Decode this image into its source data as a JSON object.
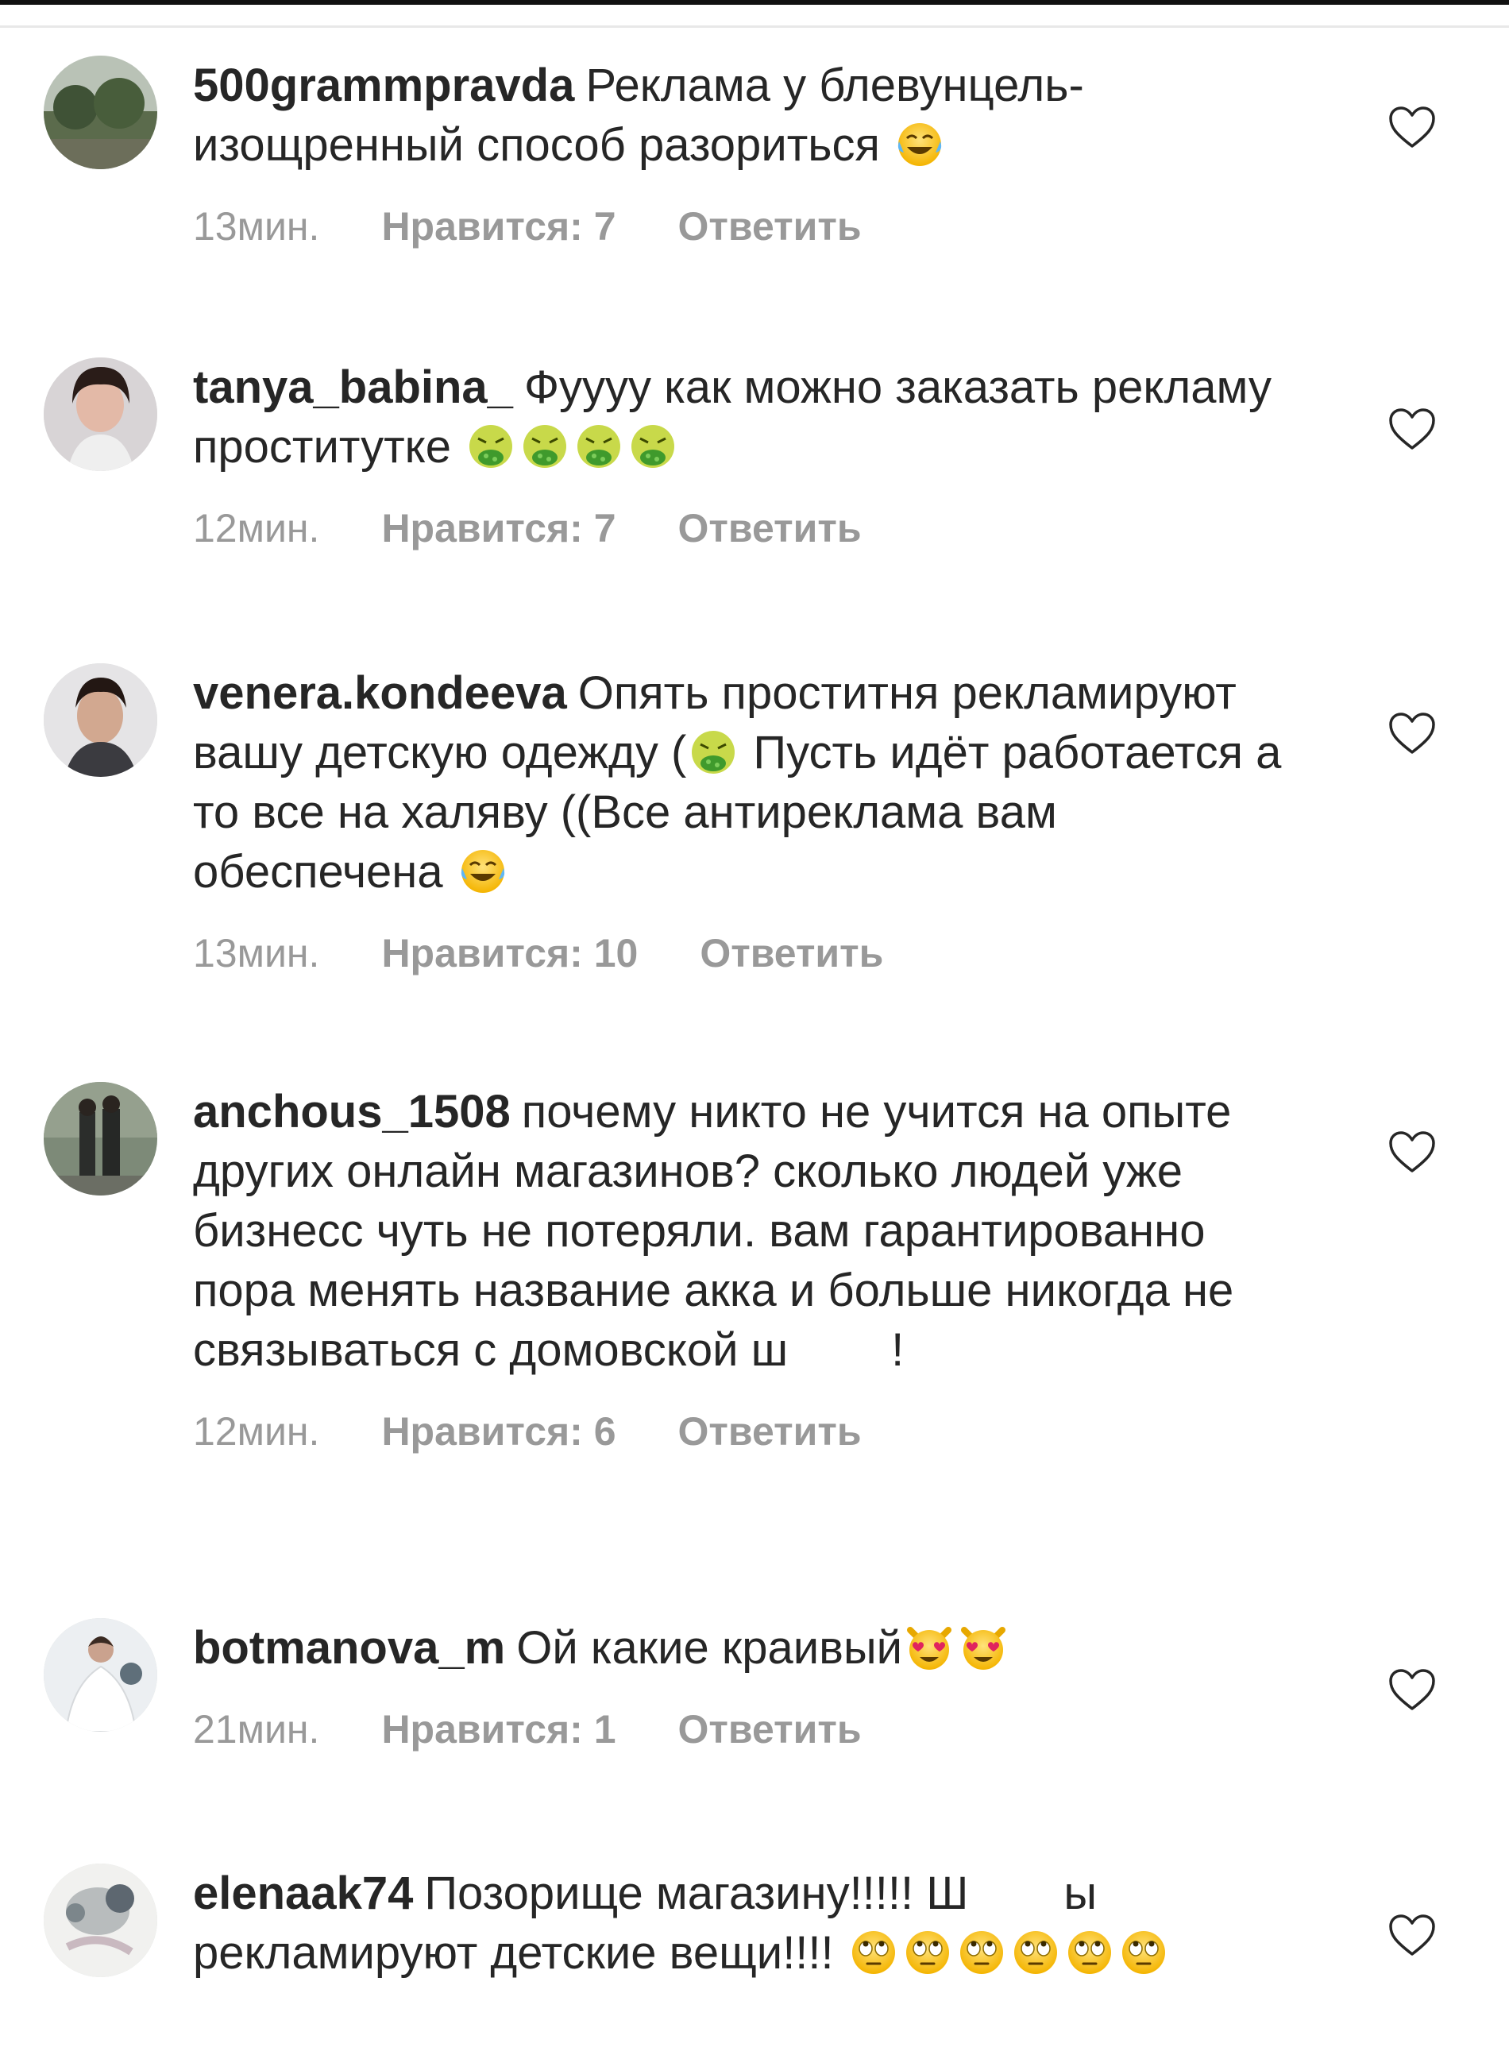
{
  "comments": [
    {
      "username": "500grammpravda",
      "text": "Реклама у блевунцель- изощренный способ разориться",
      "time": "13мин.",
      "likes": "Нравится: 7",
      "reply": "Ответить",
      "emojis": [
        "face-with-tears-of-joy"
      ],
      "avatar": "trees-photo"
    },
    {
      "username": "tanya_babina_",
      "text": "Фуууу как можно заказать рекламу проститутке",
      "time": "12мин.",
      "likes": "Нравится: 7",
      "reply": "Ответить",
      "emojis": [
        "nauseated-face",
        "nauseated-face",
        "nauseated-face",
        "nauseated-face"
      ],
      "avatar": "woman-photo"
    },
    {
      "username": "venera.kondeeva",
      "text_1": "Опять проститня рекламируют вашу детскую одежду (",
      "text_2": "Пусть идёт работается а то все на халяву ((Все антиреклама вам обеспечена",
      "time": "13мин.",
      "likes": "Нравится: 10",
      "reply": "Ответить",
      "emojis": [
        "nauseated-face",
        "face-with-tears-of-joy"
      ],
      "avatar": "man-photo"
    },
    {
      "username": "anchous_1508",
      "text_1": "почему никто не учится на опыте других онлайн магазинов? сколько людей уже бизнесс чуть не потеряли. вам гарантированно пора менять название акка и больше никогда не связываться с домовской ш",
      "text_2": "!",
      "time": "12мин.",
      "likes": "Нравится: 6",
      "reply": "Ответить",
      "avatar": "couple-photo"
    },
    {
      "username": "botmanova_m",
      "text": "Ой какие краивый",
      "time": "21мин.",
      "likes": "Нравится: 1",
      "reply": "Ответить",
      "emojis": [
        "smiling-cat-heart-eyes",
        "smiling-cat-heart-eyes"
      ],
      "avatar": "bride-photo"
    },
    {
      "username": "elenaak74",
      "text_1": "Позорище магазину!!!!! Ш",
      "text_2": "ы рекламируют детские вещи!!!!",
      "time": "",
      "likes": "",
      "reply": "",
      "emojis": [
        "face-with-rolling-eyes",
        "face-with-rolling-eyes",
        "face-with-rolling-eyes",
        "face-with-rolling-eyes",
        "face-with-rolling-eyes",
        "face-with-rolling-eyes"
      ],
      "avatar": "cat-photo"
    }
  ],
  "colors": {
    "text": "#262626",
    "meta": "#999999",
    "heart_stroke": "#262626",
    "background": "#ffffff"
  }
}
